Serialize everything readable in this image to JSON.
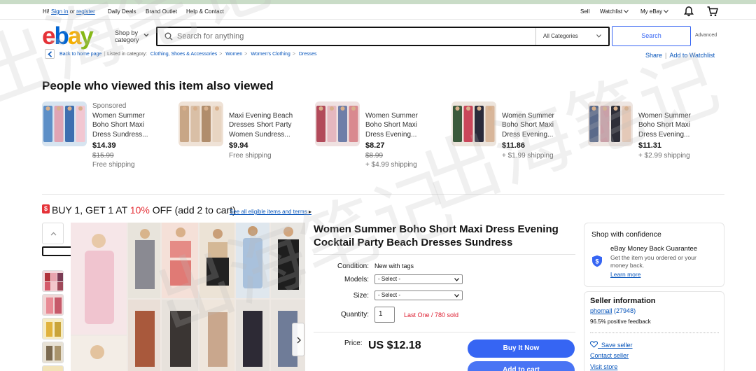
{
  "colors": {
    "link": "#0654ba",
    "button_blue": "#3665f3",
    "ebay_red": "#e53238",
    "ebay_blue": "#0064d2",
    "ebay_yellow": "#f5af02",
    "ebay_green": "#86b817",
    "stock_red": "#dd1e31"
  },
  "header": {
    "greeting": "Hi!",
    "sign_in": "Sign in",
    "or": "or",
    "register": "register",
    "links": [
      "Daily Deals",
      "Brand Outlet",
      "Help & Contact"
    ],
    "right_links": [
      "Sell",
      "Watchlist",
      "My eBay"
    ],
    "icons": [
      "bell-icon",
      "cart-icon"
    ]
  },
  "logo": {
    "letters": [
      "e",
      "b",
      "a",
      "y"
    ]
  },
  "search": {
    "shop_by": "Shop by",
    "category": "category",
    "placeholder": "Search for anything",
    "category_select": "All Categories",
    "button": "Search",
    "advanced": "Advanced"
  },
  "breadcrumb": {
    "back": "Back to home page",
    "listed_in": "Listed in category:",
    "items": [
      "Clothing, Shoes & Accessories",
      "Women",
      "Women's Clothing",
      "Dresses"
    ],
    "share": "Share",
    "watchlist": "Add to Watchlist"
  },
  "also_viewed": {
    "title": "People who viewed this item also viewed",
    "items": [
      {
        "sponsored": "Sponsored",
        "title_lines": [
          "Women Summer",
          "Boho Short Maxi",
          "Dress Sundress..."
        ],
        "price": "$14.39",
        "orig": "$15.99",
        "shipping": "Free shipping"
      },
      {
        "sponsored": "",
        "title_lines": [
          "Maxi Evening Beach",
          "Dresses Short Party",
          "Women Sundress..."
        ],
        "price": "$9.94",
        "orig": "",
        "shipping": "Free shipping"
      },
      {
        "sponsored": "",
        "title_lines": [
          "Women Summer",
          "Boho Short Maxi",
          "Dress Evening..."
        ],
        "price": "$8.27",
        "orig": "$8.99",
        "shipping": "+ $4.99 shipping"
      },
      {
        "sponsored": "",
        "title_lines": [
          "Women Summer",
          "Boho Short Maxi",
          "Dress Evening..."
        ],
        "price": "$11.86",
        "orig": "",
        "shipping": "+ $1.99 shipping"
      },
      {
        "sponsored": "",
        "title_lines": [
          "Women Summer",
          "Boho Short Maxi",
          "Dress Evening..."
        ],
        "price": "$11.31",
        "orig": "",
        "shipping": "+ $2.99 shipping"
      }
    ]
  },
  "promo": {
    "icon": "$",
    "text_a": "BUY 1, GET 1 AT ",
    "text_b": "10%",
    "text_c": " OFF (add 2 to cart)",
    "link": "See all eligible items and terms",
    "arrow": "▸"
  },
  "item": {
    "title_line1": "Women Summer Boho Short Maxi Dress Evening",
    "title_line2": "Cocktail Party Beach Dresses Sundress",
    "condition_label": "Condition:",
    "condition": "New with tags",
    "models_label": "Models:",
    "models_value": "- Select -",
    "size_label": "Size:",
    "size_value": "- Select -",
    "quantity_label": "Quantity:",
    "quantity_value": "1",
    "stock": "Last One / 780 sold",
    "price_label": "Price:",
    "price": "US $12.18",
    "buy_now": "Buy It Now",
    "add_to_cart": "Add to cart"
  },
  "confidence": {
    "title": "Shop with confidence",
    "guarantee": "eBay Money Back Guarantee",
    "desc_line1": "Get the item you ordered or your",
    "desc_line2": "money back.",
    "learn_more": "Learn more"
  },
  "seller": {
    "title": "Seller information",
    "name": "phomall",
    "score": "(27948)",
    "feedback": "96.5% positive feedback",
    "save": "Save seller",
    "contact": "Contact seller",
    "visit": "Visit store"
  },
  "watermark": "出海笔记"
}
